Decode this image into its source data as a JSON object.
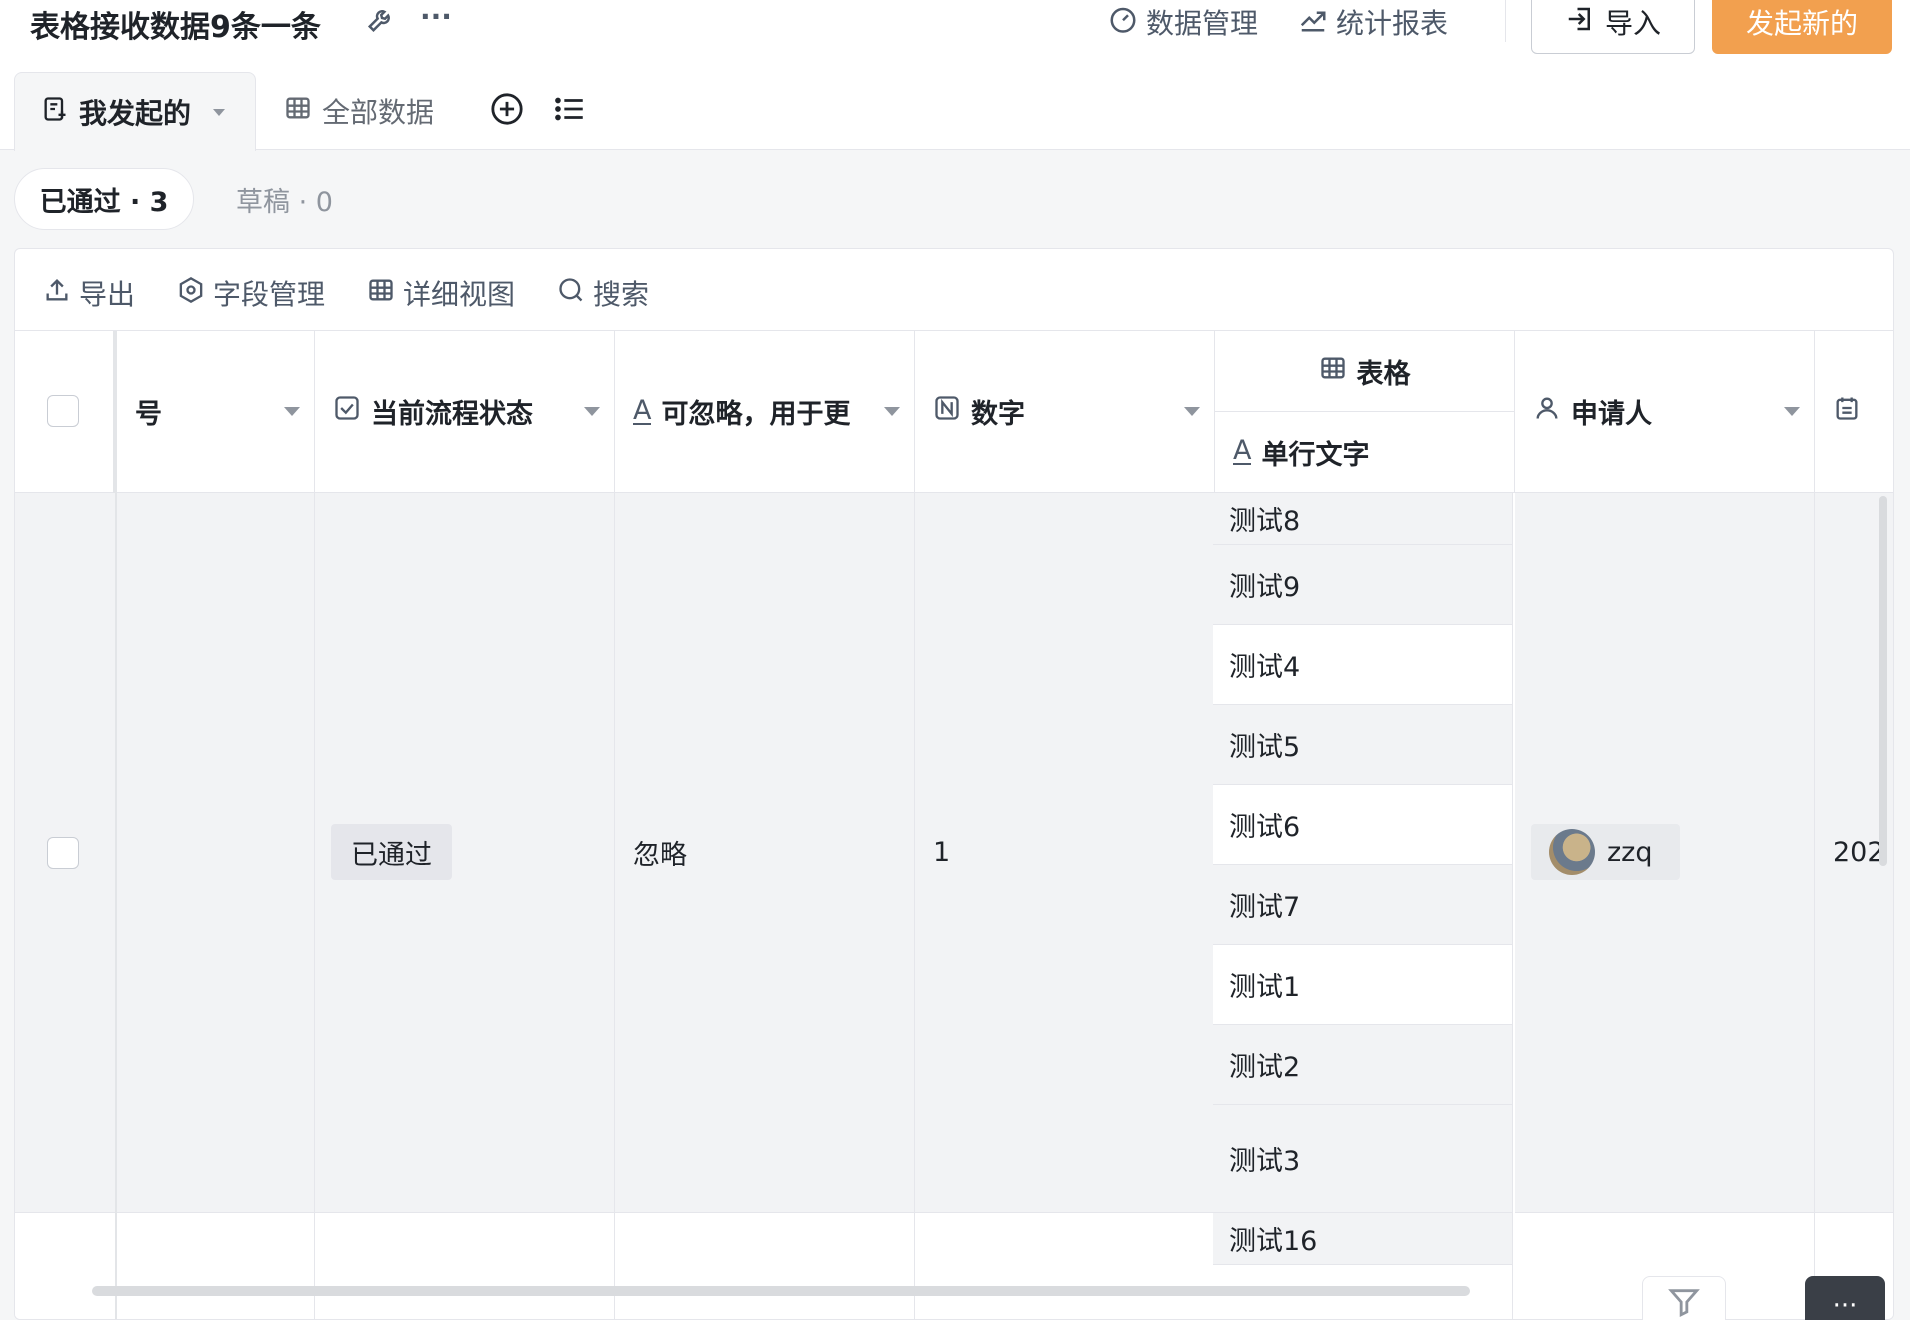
{
  "header": {
    "title": "表格接收数据9条一条",
    "more_label": "···",
    "data_manage": "数据管理",
    "stats_report": "统计报表",
    "import_label": "导入",
    "new_label": "发起新的",
    "accent_color": "#f2a04f"
  },
  "tabs": {
    "active_label": "我发起的",
    "all_data_label": "全部数据"
  },
  "filters": {
    "passed": "已通过 · 3",
    "draft": "草稿 · 0"
  },
  "toolbar": {
    "export": "导出",
    "field_manage": "字段管理",
    "detail_view": "详细视图",
    "search": "搜索"
  },
  "table": {
    "columns": {
      "serial": "号",
      "status": "当前流程状态",
      "ignorable": "可忽略，用于更",
      "number": "数字",
      "table_group": "表格",
      "single_line": "单行文字",
      "applicant": "申请人"
    },
    "row1": {
      "status": "已通过",
      "ignorable": "忽略",
      "number": "1",
      "sub_rows": [
        "测试8",
        "测试9",
        "测试4",
        "测试5",
        "测试6",
        "测试7",
        "测试1",
        "测试2",
        "测试3"
      ],
      "applicant": "zzq",
      "date": "202"
    },
    "row2": {
      "sub_first": "测试16"
    }
  }
}
